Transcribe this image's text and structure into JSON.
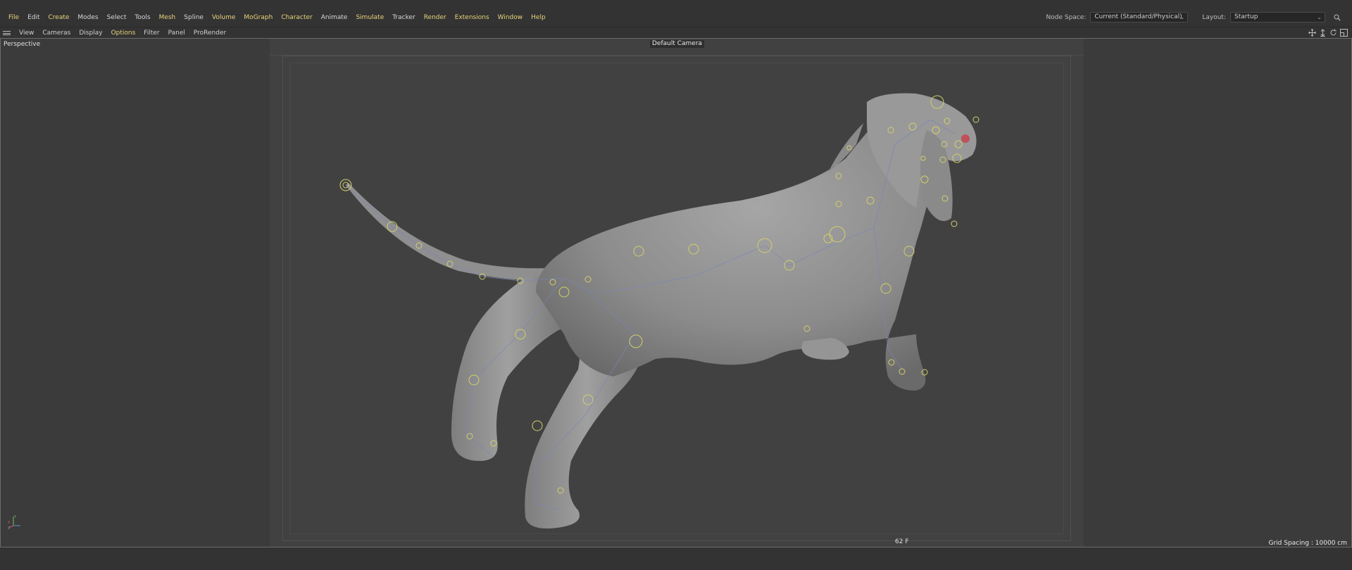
{
  "menu": {
    "items": [
      {
        "label": "File",
        "hl": true
      },
      {
        "label": "Edit",
        "hl": false
      },
      {
        "label": "Create",
        "hl": true
      },
      {
        "label": "Modes",
        "hl": false
      },
      {
        "label": "Select",
        "hl": false
      },
      {
        "label": "Tools",
        "hl": false
      },
      {
        "label": "Mesh",
        "hl": true
      },
      {
        "label": "Spline",
        "hl": false
      },
      {
        "label": "Volume",
        "hl": true
      },
      {
        "label": "MoGraph",
        "hl": true
      },
      {
        "label": "Character",
        "hl": true
      },
      {
        "label": "Animate",
        "hl": false
      },
      {
        "label": "Simulate",
        "hl": true
      },
      {
        "label": "Tracker",
        "hl": false
      },
      {
        "label": "Render",
        "hl": true
      },
      {
        "label": "Extensions",
        "hl": true
      },
      {
        "label": "Window",
        "hl": true
      },
      {
        "label": "Help",
        "hl": true
      }
    ],
    "node_space_label": "Node Space:",
    "node_space_value": "Current (Standard/Physical)",
    "layout_label": "Layout:",
    "layout_value": "Startup"
  },
  "viewport_menu": {
    "items": [
      {
        "label": "View",
        "hl": false
      },
      {
        "label": "Cameras",
        "hl": false
      },
      {
        "label": "Display",
        "hl": false
      },
      {
        "label": "Options",
        "hl": true
      },
      {
        "label": "Filter",
        "hl": false
      },
      {
        "label": "Panel",
        "hl": false
      },
      {
        "label": "ProRender",
        "hl": false
      }
    ]
  },
  "viewport": {
    "projection": "Perspective",
    "camera": "Default Camera",
    "frame": "62 F",
    "grid_spacing": "Grid Spacing : 10000 cm"
  },
  "colors": {
    "menu_highlight": "#e8d47a",
    "joint": "#d4cf6a",
    "bone": "#7a86b8",
    "model": "#8e8e8e",
    "nose": "#c0505a"
  }
}
